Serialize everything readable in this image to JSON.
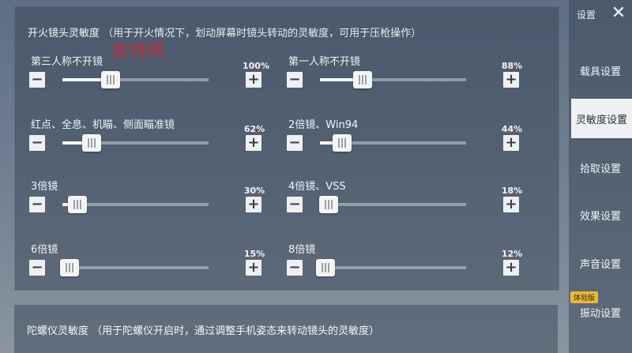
{
  "sensitivity": {
    "title": "开火镜头灵敏度",
    "hint": "（用于开火情况下，划动屏幕时镜头转动的灵敏度，可用于压枪操作）",
    "watermark": "思特网",
    "sliders": [
      {
        "label": "第三人称不开镜",
        "percent_text": "100%",
        "value": 0.33
      },
      {
        "label": "第一人称不开镜",
        "percent_text": "88%",
        "value": 0.29
      },
      {
        "label": "红点、全息、机瞄、侧面瞄准镜",
        "percent_text": "62%",
        "value": 0.2
      },
      {
        "label": "2倍镜、Win94",
        "percent_text": "44%",
        "value": 0.15
      },
      {
        "label": "3倍镜",
        "percent_text": "30%",
        "value": 0.1
      },
      {
        "label": "4倍镜、VSS",
        "percent_text": "18%",
        "value": 0.06
      },
      {
        "label": "6倍镜",
        "percent_text": "15%",
        "value": 0.05
      },
      {
        "label": "8倍镜",
        "percent_text": "12%",
        "value": 0.04
      }
    ],
    "minus_symbol": "−",
    "plus_symbol": "+"
  },
  "gyro": {
    "title": "陀螺仪灵敏度",
    "hint": "（用于陀螺仪开启时，通过调整手机姿态来转动镜头的灵敏度）"
  },
  "sidebar": {
    "top_label": "设置",
    "close_symbol": "✕",
    "items": [
      {
        "label": "载具设置"
      },
      {
        "label": "灵敏度设置"
      },
      {
        "label": "拾取设置"
      },
      {
        "label": "效果设置"
      },
      {
        "label": "声音设置"
      },
      {
        "label": "振动设置"
      }
    ],
    "badge": "体验版"
  },
  "colors": {
    "active_tab_bg": "#eef0f2",
    "badge": "#e9b93a",
    "watermark": "#d62832"
  }
}
